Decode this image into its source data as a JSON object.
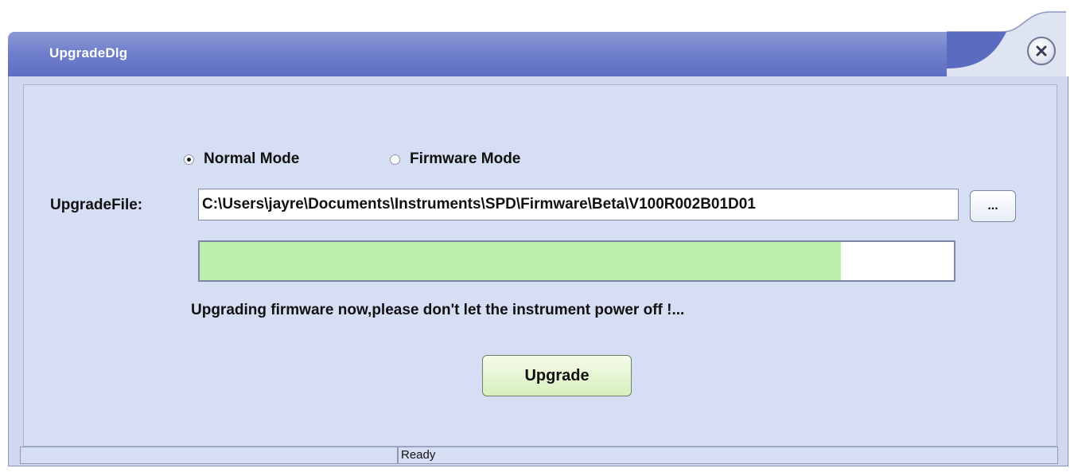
{
  "window": {
    "title": "UpgradeDlg"
  },
  "mode": {
    "options": [
      {
        "label": "Normal Mode",
        "selected": true
      },
      {
        "label": "Firmware Mode",
        "selected": false
      }
    ]
  },
  "upgrade_file": {
    "label": "UpgradeFile:",
    "value": "C:\\Users\\jayre\\Documents\\Instruments\\SPD\\Firmware\\Beta\\V100R002B01D01",
    "browse_label": "..."
  },
  "progress": {
    "fraction": 0.85
  },
  "message": "Upgrading firmware now,please don't let the instrument power off !...",
  "buttons": {
    "upgrade_label": "Upgrade"
  },
  "statusbar": {
    "panes": [
      "",
      "Ready"
    ]
  },
  "colors": {
    "title_bar": "#6f7fcb",
    "body": "#d6def4",
    "progress_fill": "#bbefad",
    "upgrade_button": "#d7f0bd"
  },
  "icons": {
    "close": "close-icon"
  }
}
